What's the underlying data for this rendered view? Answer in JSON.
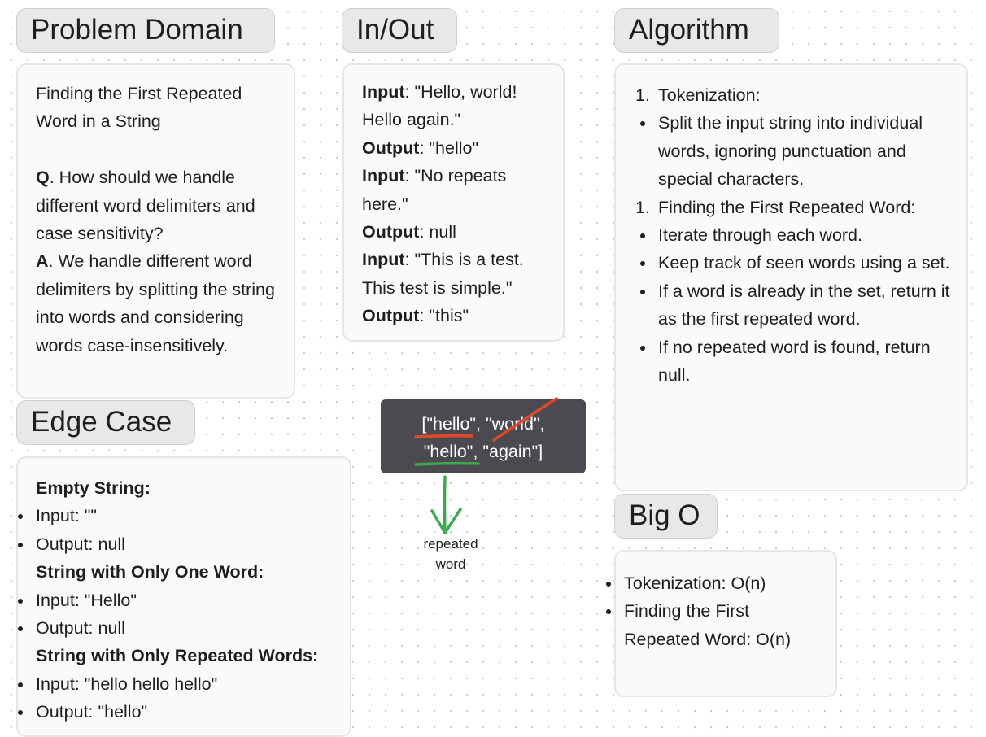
{
  "problem_domain": {
    "title": "Problem Domain",
    "statement": "Finding the First Repeated Word in a String",
    "q_label": "Q",
    "q_text": ". How should we handle different word delimiters and case sensitivity?",
    "a_label": "A",
    "a_text": ". We handle different word delimiters by splitting the string into words and considering words case-insensitively."
  },
  "in_out": {
    "title": "In/Out",
    "input_label": "Input",
    "output_label": "Output",
    "examples": [
      {
        "input": ": \"Hello, world! Hello again.\"",
        "output": ": \"hello\""
      },
      {
        "input": ": \"No repeats here.\"",
        "output": ": null"
      },
      {
        "input": ": \"This is a test. This test is simple.\"",
        "output": ": \"this\""
      }
    ]
  },
  "algorithm": {
    "title": "Algorithm",
    "steps": [
      {
        "number": "1.",
        "label": "Tokenization:",
        "bullets": [
          "Split the input string into individual words, ignoring punctuation and special characters."
        ]
      },
      {
        "number": "1.",
        "label": "Finding the First Repeated Word:",
        "bullets": [
          "Iterate through each word.",
          "Keep track of seen words using a set.",
          "If a word is already in the set, return it as the first repeated word.",
          "If no repeated word is found, return null."
        ]
      }
    ]
  },
  "edge_case": {
    "title": "Edge Case",
    "sections": [
      {
        "heading": "Empty String:",
        "items": [
          "Input: \"\"",
          "Output: null"
        ]
      },
      {
        "heading": "String with Only One Word:",
        "items": [
          "Input: \"Hello\"",
          "Output: null"
        ]
      },
      {
        "heading": "String with Only Repeated Words:",
        "items": [
          "Input: \"hello hello hello\"",
          "Output: \"hello\""
        ]
      }
    ]
  },
  "big_o": {
    "title": "Big O",
    "items": [
      "Tokenization: O(n)",
      "Finding the First Repeated Word: O(n)"
    ]
  },
  "example_box": {
    "line1": "[\"hello\", \"world\",",
    "line2": "\"hello\", \"again\"]",
    "note": "repeated word"
  },
  "colors": {
    "strike_red": "#e0482a",
    "arrow_green": "#3daa4f"
  }
}
